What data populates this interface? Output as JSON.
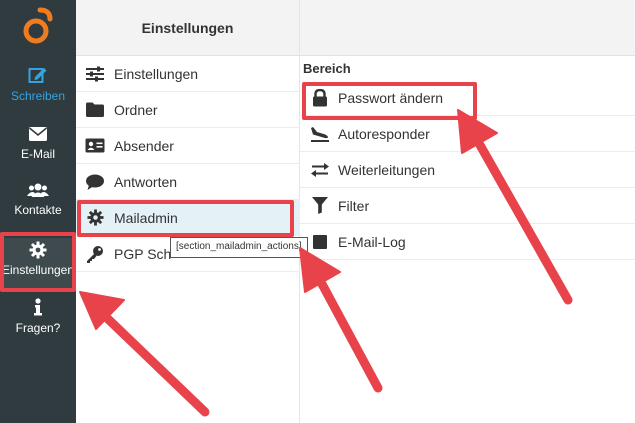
{
  "rail": {
    "items": [
      {
        "label": "Schreiben",
        "icon": "compose-icon"
      },
      {
        "label": "E-Mail",
        "icon": "envelope-icon"
      },
      {
        "label": "Kontakte",
        "icon": "people-icon"
      },
      {
        "label": "Einstellungen",
        "icon": "gear-icon"
      },
      {
        "label": "Fragen?",
        "icon": "info-icon"
      }
    ]
  },
  "middle": {
    "header": "Einstellungen",
    "items": [
      {
        "label": "Einstellungen",
        "icon": "sliders-icon"
      },
      {
        "label": "Ordner",
        "icon": "folder-icon"
      },
      {
        "label": "Absender",
        "icon": "id-card-icon"
      },
      {
        "label": "Antworten",
        "icon": "chat-bubble-icon"
      },
      {
        "label": "Mailadmin",
        "icon": "gear-icon"
      },
      {
        "label": "PGP Sch",
        "icon": "key-icon"
      }
    ]
  },
  "tooltip": "[section_mailadmin_actions]",
  "right": {
    "section_title": "Bereich",
    "items": [
      {
        "label": "Passwort ändern",
        "icon": "lock-icon"
      },
      {
        "label": "Autoresponder",
        "icon": "plane-landing-icon"
      },
      {
        "label": "Weiterleitungen",
        "icon": "swap-arrows-icon"
      },
      {
        "label": "Filter",
        "icon": "funnel-icon"
      },
      {
        "label": "E-Mail-Log",
        "icon": "log-icon"
      }
    ]
  },
  "colors": {
    "rail_bg": "#2f3b3f",
    "accent": "#34a3e0",
    "brand_orange": "#f07c22",
    "annotation_red": "#e8434b",
    "selected_bg": "#e4f2f8"
  }
}
